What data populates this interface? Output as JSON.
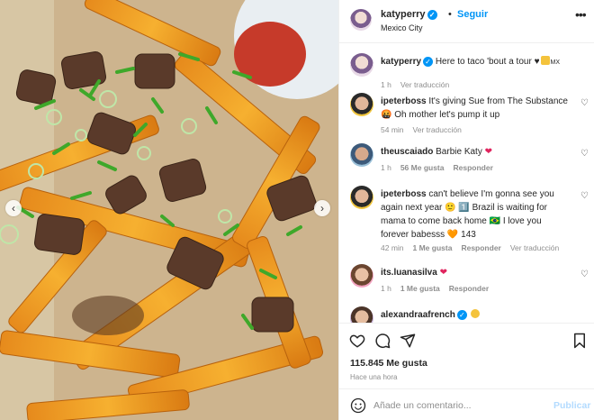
{
  "colors": {
    "accent": "#0095f6",
    "secondary_text": "#8e8e8e",
    "heart": "#ed4956"
  },
  "carousel": {
    "prev_icon": "chevron-left-icon",
    "next_icon": "chevron-right-icon",
    "prev_glyph": "‹",
    "next_glyph": "›"
  },
  "header": {
    "username": "katyperry",
    "verified_glyph": "✓",
    "separator": "•",
    "follow_label": "Seguir",
    "location": "Mexico City",
    "more_glyph": "•••"
  },
  "caption": {
    "username": "katyperry",
    "text": "Here to taco 'bout a tour ♥",
    "suffix": "MX",
    "time": "1 h",
    "translate": "Ver traducción"
  },
  "comments": [
    {
      "username": "ipeterboss",
      "text": "It's giving Sue from The Substance 🤬 Oh mother let's pump it up",
      "time": "54 min",
      "translate": "Ver traducción"
    },
    {
      "username": "theuscaiado",
      "text": "Barbie Katy",
      "time": "1 h",
      "likes": "56 Me gusta",
      "reply": "Responder"
    },
    {
      "username": "ipeterboss",
      "text": "can't believe I'm gonna see you again next year 🙂 1️⃣ Brazil is waiting for mama to come back home 🇧🇷 I love you forever babesss 🧡 143",
      "time": "42 min",
      "likes": "1 Me gusta",
      "reply": "Responder",
      "translate": "Ver traducción"
    },
    {
      "username": "its.luanasilva",
      "text": "",
      "time": "1 h",
      "likes": "1 Me gusta",
      "reply": "Responder"
    },
    {
      "username": "alexandraafrench",
      "text": ""
    }
  ],
  "footer": {
    "likes": "115.845 Me gusta",
    "time_ago": "Hace una hora",
    "comment_placeholder": "Añade un comentario...",
    "post_label": "Publicar"
  }
}
